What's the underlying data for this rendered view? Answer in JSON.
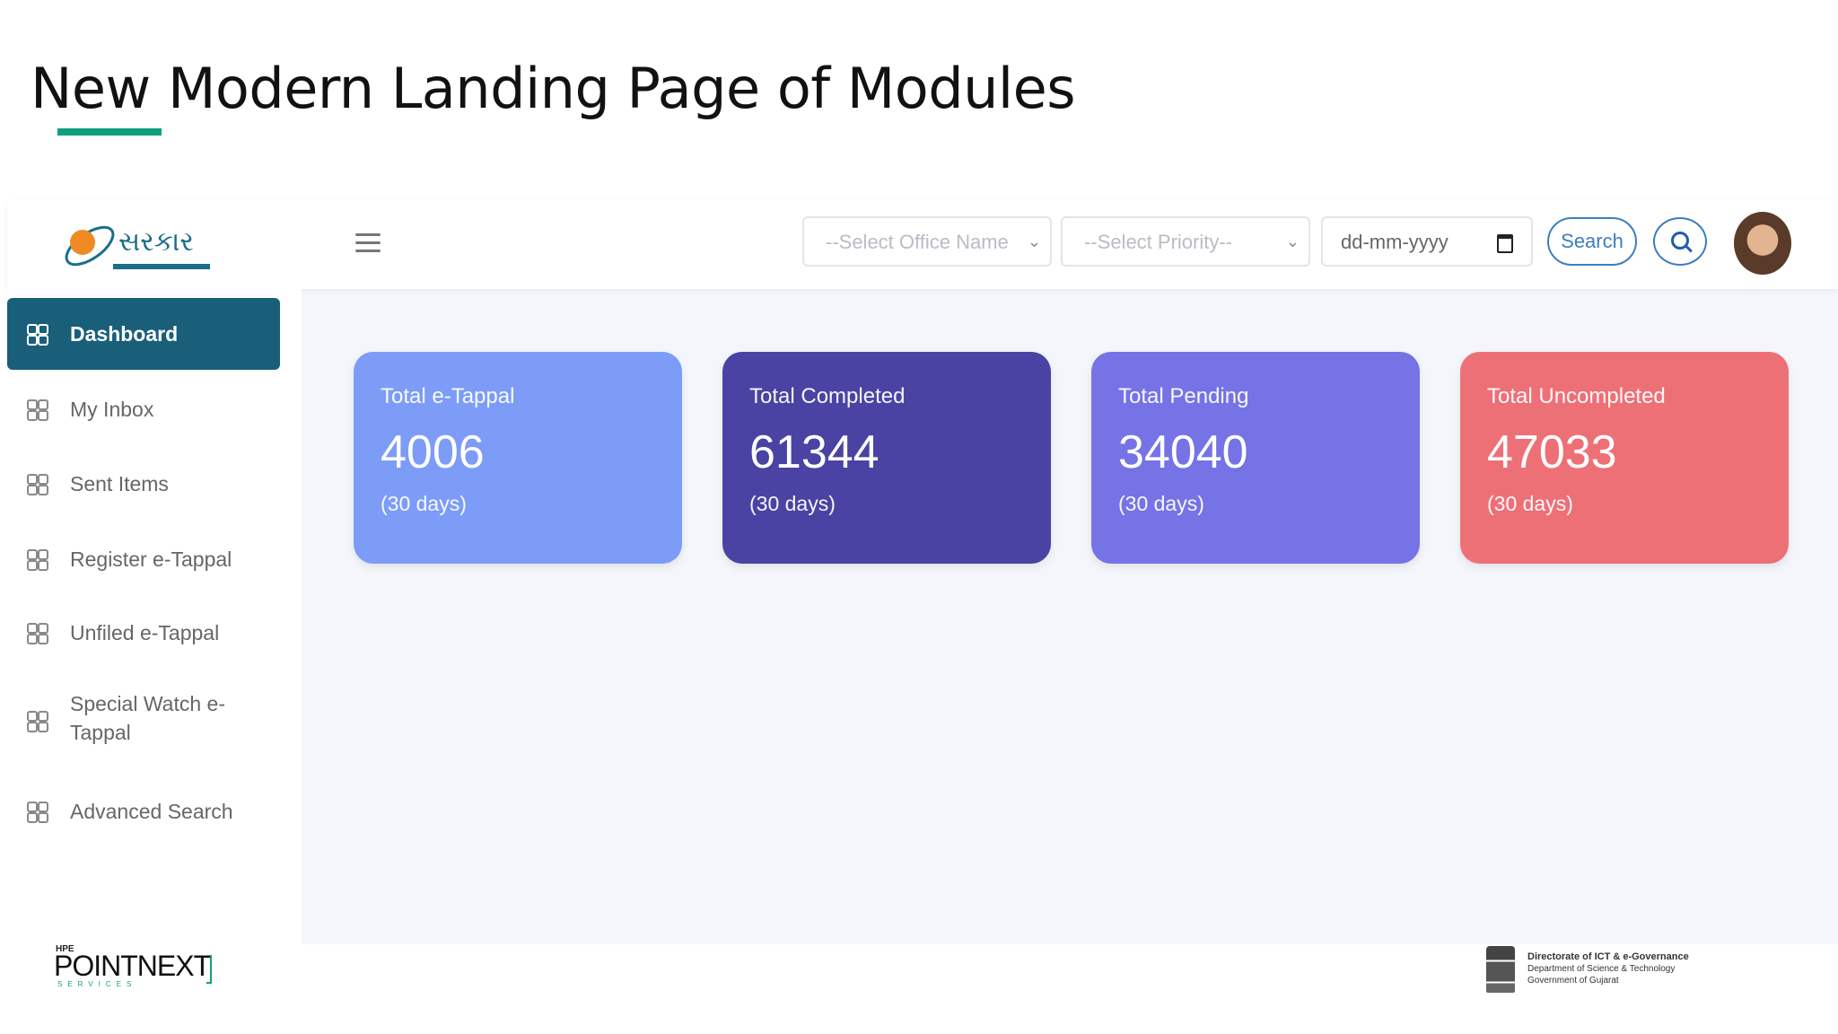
{
  "slide": {
    "title": "New Modern Landing Page of Modules"
  },
  "header": {
    "logo_text": "સરકાર",
    "office_select": {
      "value": "--Select Office Name"
    },
    "priority_select": {
      "value": "--Select Priority--"
    },
    "date_input": {
      "placeholder": "dd-mm-yyyy"
    },
    "search_label": "Search",
    "icons": {
      "menu": "hamburger-menu-icon",
      "calendar": "calendar-icon",
      "search": "search-icon",
      "avatar": "user-avatar"
    }
  },
  "sidebar": {
    "items": [
      {
        "label": "Dashboard",
        "active": true
      },
      {
        "label": "My Inbox",
        "active": false
      },
      {
        "label": "Sent Items",
        "active": false
      },
      {
        "label": "Register e-Tappal",
        "active": false
      },
      {
        "label": "Unfiled e-Tappal",
        "active": false
      },
      {
        "label": "Special Watch e-Tappal",
        "active": false
      },
      {
        "label": "Advanced Search",
        "active": false
      }
    ]
  },
  "cards": [
    {
      "title": "Total e-Tappal",
      "value": "4006",
      "sub": "(30 days)",
      "color": "#7d9cf7"
    },
    {
      "title": "Total Completed",
      "value": "61344",
      "sub": "(30 days)",
      "color": "#4a43a3"
    },
    {
      "title": "Total Pending",
      "value": "34040",
      "sub": "(30 days)",
      "color": "#7573e6"
    },
    {
      "title": "Total Uncompleted",
      "value": "47033",
      "sub": "(30 days)",
      "color": "#ee7077"
    }
  ],
  "footer": {
    "left_logo": {
      "brand": "HPE",
      "name": "POINTNEXT",
      "tagline": "SERVICES"
    },
    "right_logo": {
      "line1": "Directorate of ICT & e-Governance",
      "line2": "Department of Science & Technology",
      "line3": "Government of Gujarat"
    }
  },
  "colors": {
    "accent": "#0f9f7c",
    "sidebar_active": "#1a5f7a",
    "search_blue": "#3b7ec0"
  }
}
